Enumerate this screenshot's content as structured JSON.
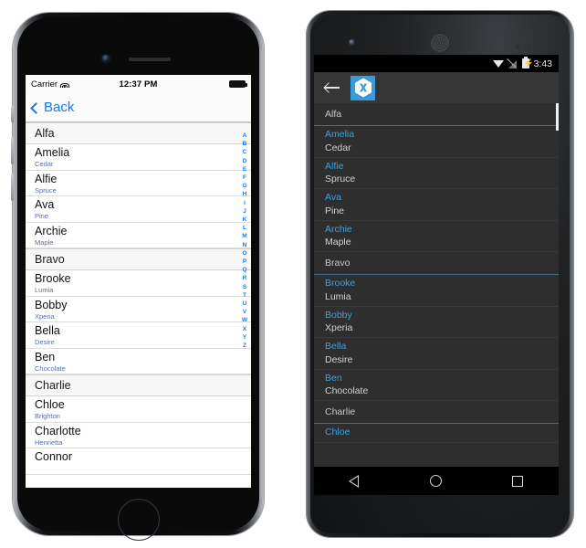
{
  "ios": {
    "status": {
      "carrier": "Carrier",
      "wifi_icon": "wifi-icon",
      "time": "12:37 PM",
      "battery_icon": "battery-full-icon"
    },
    "navbar": {
      "back_label": "Back",
      "back_icon": "chevron-left-icon"
    },
    "index_letters": [
      "A",
      "B",
      "C",
      "D",
      "E",
      "F",
      "G",
      "H",
      "I",
      "J",
      "K",
      "L",
      "M",
      "N",
      "O",
      "P",
      "Q",
      "R",
      "S",
      "T",
      "U",
      "V",
      "W",
      "X",
      "Y",
      "Z"
    ],
    "list": [
      {
        "type": "header",
        "name": "Alfa"
      },
      {
        "type": "row",
        "name": "Amelia",
        "detail": "Cedar"
      },
      {
        "type": "row",
        "name": "Alfie",
        "detail": "Spruce"
      },
      {
        "type": "row",
        "name": "Ava",
        "detail": "Pine"
      },
      {
        "type": "row",
        "name": "Archie",
        "detail": "Maple"
      },
      {
        "type": "header",
        "name": "Bravo"
      },
      {
        "type": "row",
        "name": "Brooke",
        "detail": "Lumia"
      },
      {
        "type": "row",
        "name": "Bobby",
        "detail": "Xperia"
      },
      {
        "type": "row",
        "name": "Bella",
        "detail": "Desire"
      },
      {
        "type": "row",
        "name": "Ben",
        "detail": "Chocolate"
      },
      {
        "type": "header",
        "name": "Charlie"
      },
      {
        "type": "row",
        "name": "Chloe",
        "detail": "Brighton"
      },
      {
        "type": "row",
        "name": "Charlotte",
        "detail": "Henrietta"
      },
      {
        "type": "row",
        "name": "Connor",
        "detail": ""
      }
    ]
  },
  "android": {
    "status": {
      "wifi_icon": "wifi-icon",
      "signal_icon": "signal-off-icon",
      "battery_icon": "battery-charging-icon",
      "time": "3:43"
    },
    "toolbar": {
      "back_icon": "arrow-back-icon",
      "logo_icon": "xamarin-logo-icon"
    },
    "list": [
      {
        "type": "header",
        "name": "Alfa"
      },
      {
        "type": "row",
        "name": "Amelia",
        "detail": "Cedar"
      },
      {
        "type": "row",
        "name": "Alfie",
        "detail": "Spruce"
      },
      {
        "type": "row",
        "name": "Ava",
        "detail": "Pine"
      },
      {
        "type": "row",
        "name": "Archie",
        "detail": "Maple"
      },
      {
        "type": "header",
        "name": "Bravo"
      },
      {
        "type": "row",
        "name": "Brooke",
        "detail": "Lumia"
      },
      {
        "type": "row",
        "name": "Bobby",
        "detail": "Xperia"
      },
      {
        "type": "row",
        "name": "Bella",
        "detail": "Desire"
      },
      {
        "type": "row",
        "name": "Ben",
        "detail": "Chocolate"
      },
      {
        "type": "header",
        "name": "Charlie"
      },
      {
        "type": "row",
        "name": "Chloe",
        "detail": ""
      }
    ],
    "navbar": {
      "back_icon": "nav-back-icon",
      "home_icon": "nav-home-icon",
      "recents_icon": "nav-recents-icon"
    }
  },
  "colors": {
    "ios_accent": "#0a7cff",
    "ios_detail": "#5b6ea8",
    "android_accent": "#3ea2dd",
    "android_bg": "#2e2e2e",
    "xamarin_blue": "#3a9bd9"
  }
}
